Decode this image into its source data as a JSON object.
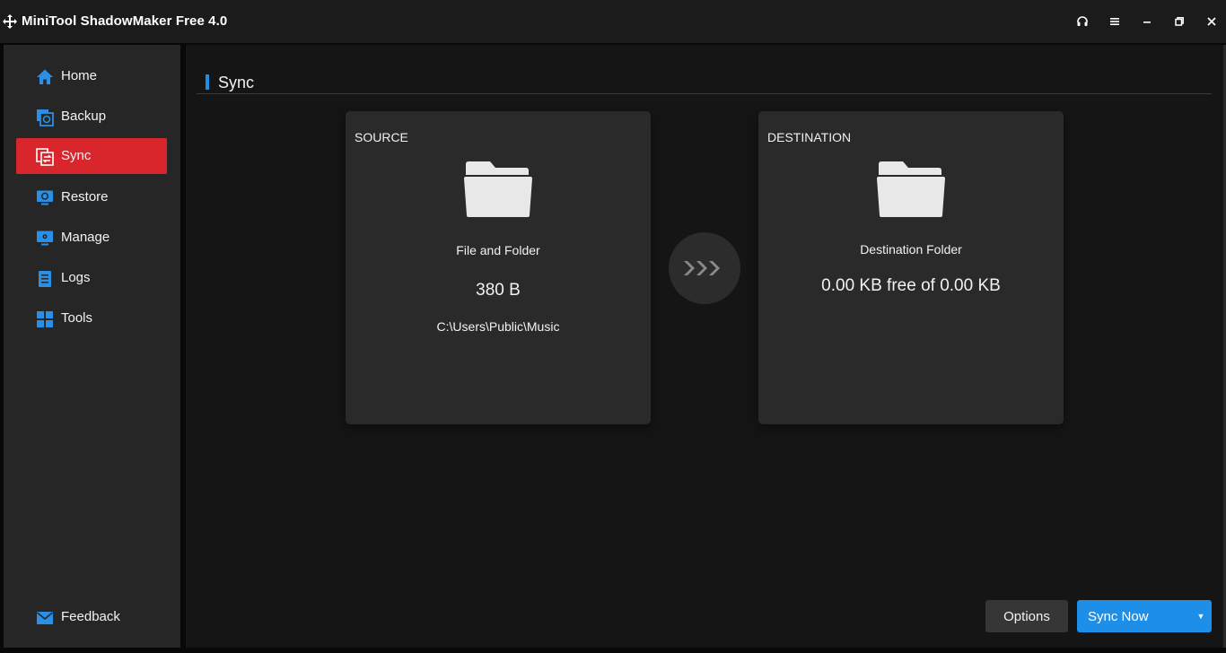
{
  "window": {
    "title": "MiniTool ShadowMaker Free 4.0"
  },
  "window_controls": [
    "headphones-icon",
    "menu-icon",
    "minimize-icon",
    "restore-icon",
    "close-icon"
  ],
  "sidebar": {
    "items": [
      {
        "label": "Home",
        "icon": "home-icon",
        "active": false
      },
      {
        "label": "Backup",
        "icon": "backup-icon",
        "active": false
      },
      {
        "label": "Sync",
        "icon": "sync-icon",
        "active": true
      },
      {
        "label": "Restore",
        "icon": "restore-icon",
        "active": false
      },
      {
        "label": "Manage",
        "icon": "manage-icon",
        "active": false
      },
      {
        "label": "Logs",
        "icon": "logs-icon",
        "active": false
      },
      {
        "label": "Tools",
        "icon": "tools-icon",
        "active": false
      }
    ],
    "feedback": {
      "label": "Feedback",
      "icon": "mail-icon"
    }
  },
  "main": {
    "section_title": "Sync",
    "source": {
      "heading": "SOURCE",
      "type": "File and Folder",
      "size": "380 B",
      "path": "C:\\Users\\Public\\Music"
    },
    "destination": {
      "heading": "DESTINATION",
      "type": "Destination Folder",
      "space": "0.00 KB free of 0.00 KB"
    }
  },
  "actions": {
    "options_label": "Options",
    "sync_now_label": "Sync Now",
    "dropdown_caret": "▼"
  },
  "colors": {
    "accent_blue": "#1e8fe8",
    "active_red": "#d8262c",
    "sidebar_bg": "#262626",
    "main_bg": "#151515",
    "card_bg": "#2a2a2a"
  }
}
